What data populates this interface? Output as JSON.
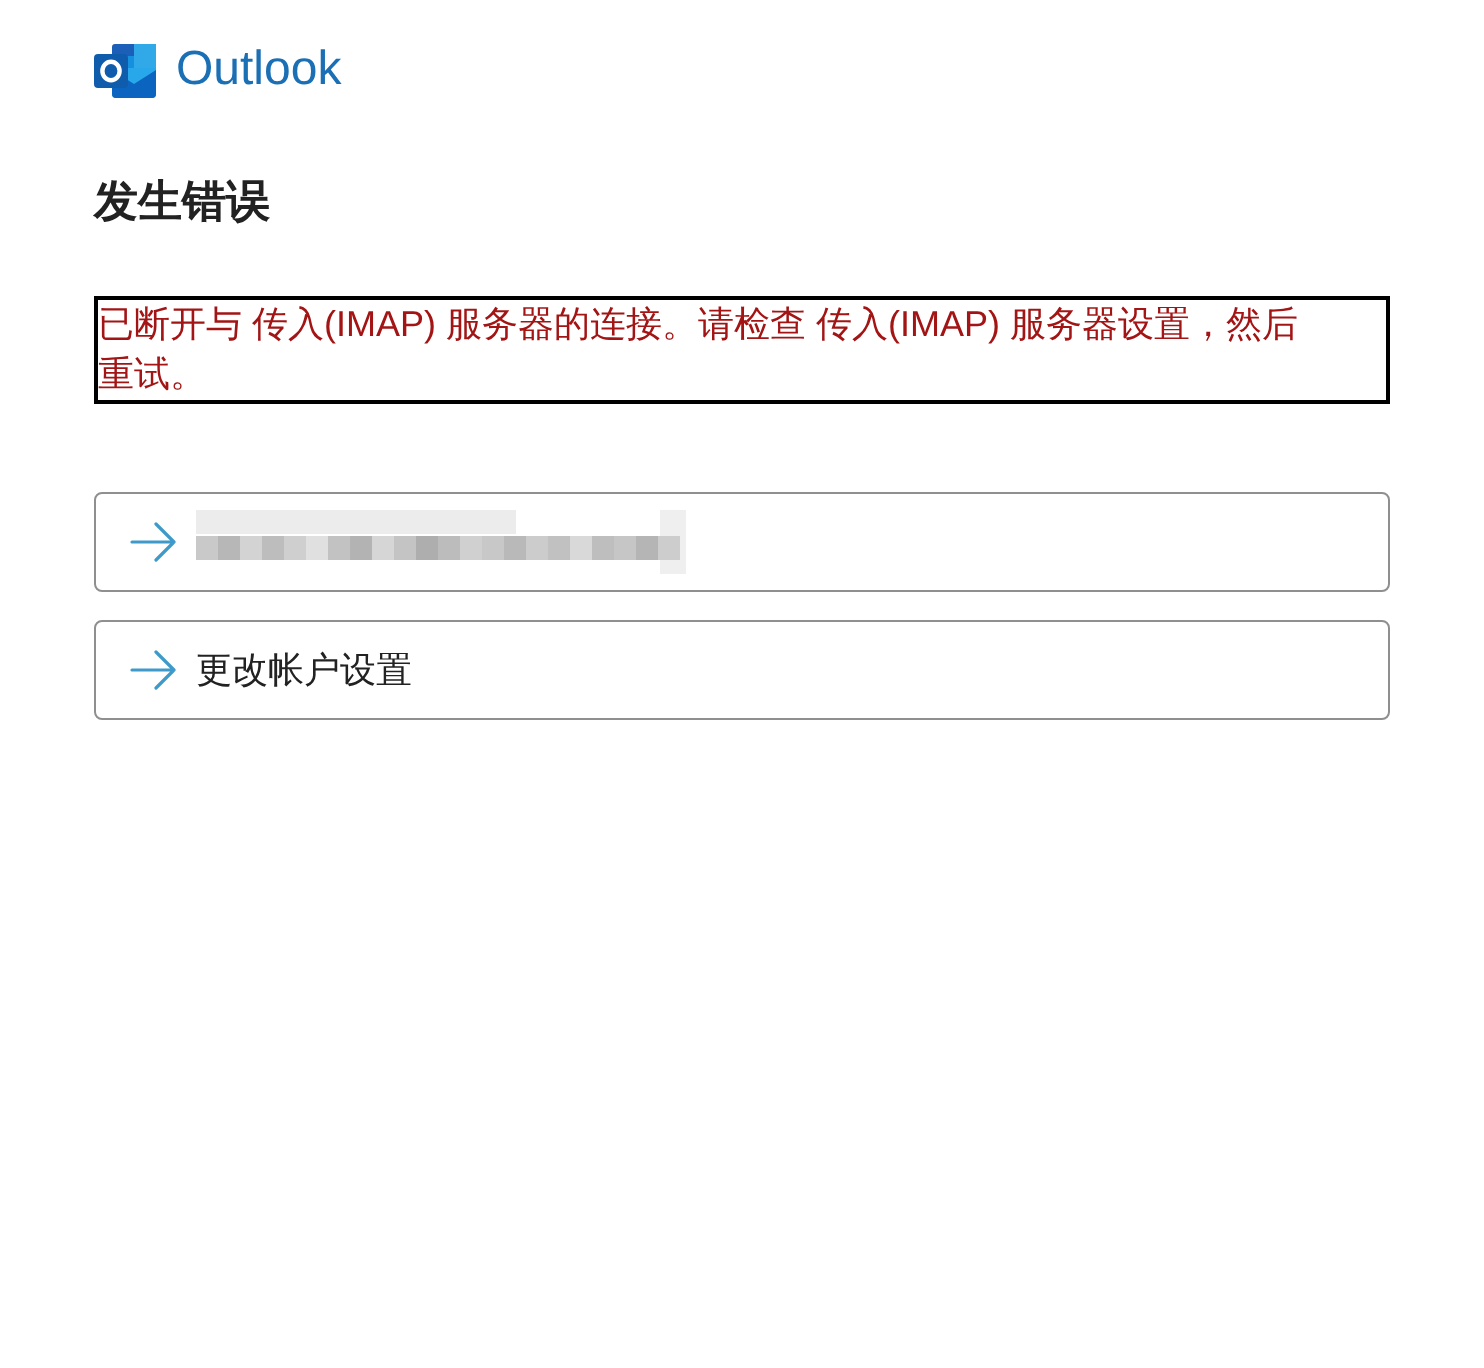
{
  "brand": {
    "name": "Outlook"
  },
  "heading": "发生错误",
  "error": {
    "message": "已断开与 传入(IMAP) 服务器的连接。请检查 传入(IMAP) 服务器设置，然后重试。"
  },
  "options": [
    {
      "kind": "redacted"
    },
    {
      "kind": "text",
      "label": "更改帐户设置"
    }
  ]
}
